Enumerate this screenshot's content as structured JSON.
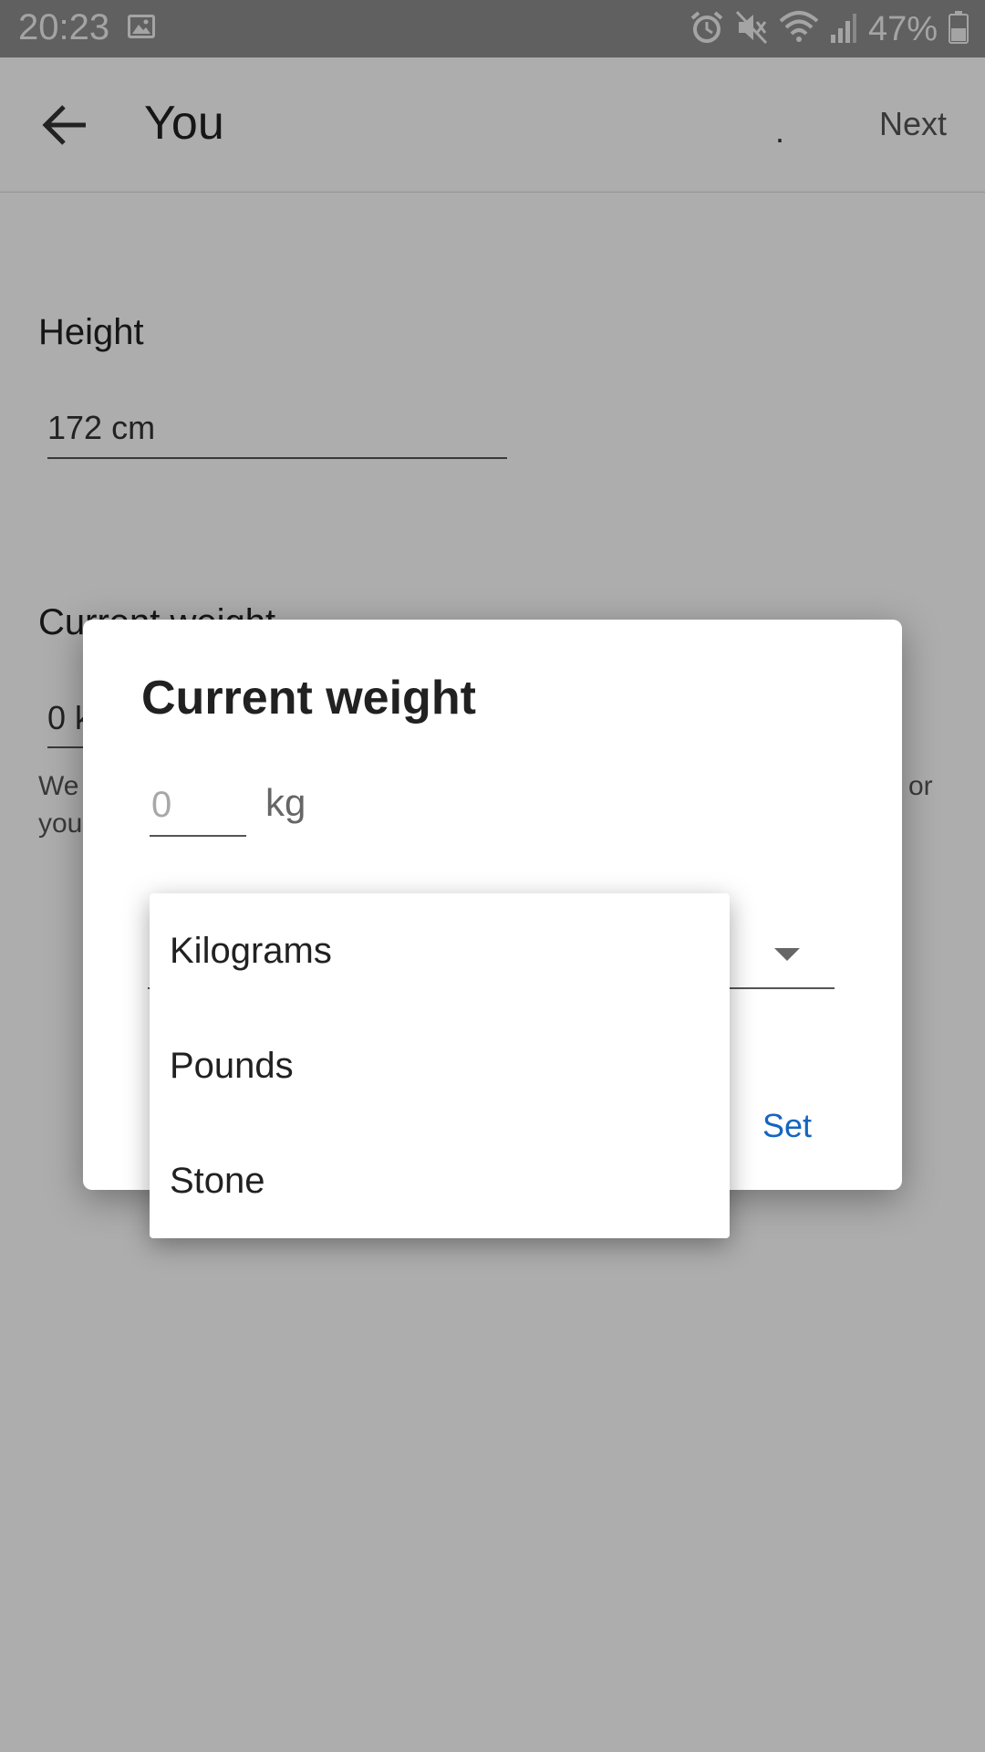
{
  "status_bar": {
    "time": "20:23",
    "battery_percent": "47%",
    "icons": [
      "gallery-icon",
      "alarm-icon",
      "mute-icon",
      "wifi-icon",
      "signal-icon",
      "battery-icon"
    ]
  },
  "app_bar": {
    "title": "You",
    "dot": ".",
    "next_label": "Next"
  },
  "form": {
    "height_label": "Height",
    "height_value": "172 cm",
    "weight_label": "Current weight",
    "weight_value_partial": "0 k",
    "hint_left": "We",
    "hint_left_2": "you",
    "hint_right": "or"
  },
  "dialog": {
    "title": "Current weight",
    "weight_placeholder": "0",
    "unit_label": "kg",
    "set_label": "Set"
  },
  "unit_menu": {
    "options": [
      "Kilograms",
      "Pounds",
      "Stone"
    ]
  },
  "colors": {
    "accent": "#1565c0",
    "status_bar": "#8e8e8e",
    "scrim": "rgba(0,0,0,0.32)"
  }
}
